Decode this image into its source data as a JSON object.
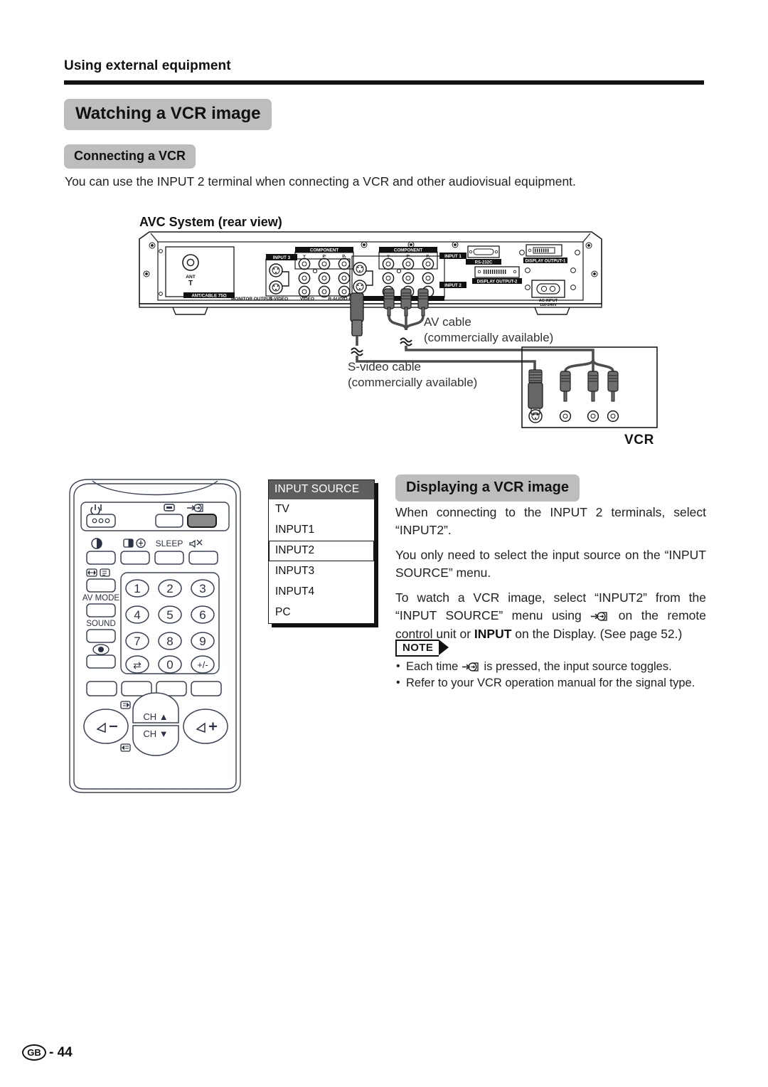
{
  "header": {
    "running_head": "Using external equipment"
  },
  "sections": {
    "watching_title": "Watching a VCR image",
    "connecting_title": "Connecting a VCR",
    "intro_text": "You can use the INPUT 2 terminal when connecting a VCR and other audiovisual equipment.",
    "avc_label": "AVC System (rear view)",
    "displaying_title": "Displaying a VCR image"
  },
  "diagram": {
    "av_cable_caption": "AV cable\n(commercially available)",
    "svideo_cable_caption": "S-video cable\n(commercially available)",
    "vcr_label": "VCR",
    "rear_panel_labels": {
      "ant": "ANT",
      "ant_cable": "ANT/CABLE 75Ω",
      "monitor_output": "MONITOR OUTPUT",
      "s_video": "S-VIDEO",
      "video": "VIDEO",
      "r_audio_l": "R-AUDIO-L",
      "component": "COMPONENT",
      "component_y": "Y",
      "component_pb": "PB",
      "component_pr": "PR",
      "input1": "INPUT 1",
      "input2": "INPUT 2",
      "input3": "INPUT 3",
      "rs232c": "RS-232C",
      "display_output_1": "DISPLAY OUTPUT-1",
      "display_output_2": "DISPLAY OUTPUT-2",
      "ac_input": "AC INPUT",
      "ac_input_volts": "110-240V"
    }
  },
  "input_source_menu": {
    "title": "INPUT SOURCE",
    "items": [
      {
        "label": "TV",
        "selected": false
      },
      {
        "label": "INPUT1",
        "selected": false
      },
      {
        "label": "INPUT2",
        "selected": true
      },
      {
        "label": "INPUT3",
        "selected": false
      },
      {
        "label": "INPUT4",
        "selected": false
      },
      {
        "label": "PC",
        "selected": false
      }
    ]
  },
  "displaying": {
    "p1": "When connecting to the INPUT 2 terminals, select “INPUT2”.",
    "p2": "You only need to select the input source on the “INPUT SOURCE” menu.",
    "p3_before": "To watch a VCR image, select “INPUT2” from the “INPUT SOURCE” menu using ",
    "p3_middle": " on the remote control unit or ",
    "p3_bold": "INPUT",
    "p3_after": " on the Display. (See page 52.)"
  },
  "note": {
    "tag": "NOTE",
    "item1_before": "Each time ",
    "item1_after": " is pressed, the input source toggles.",
    "item2": "Refer to your VCR operation manual for the signal type."
  },
  "remote": {
    "buttons": {
      "power": "power-icon",
      "display": "display-icon",
      "input": "input-icon",
      "sleep": "SLEEP",
      "av_mode": "AV MODE",
      "sound": "SOUND",
      "ch_up": "CH",
      "ch_down": "CH",
      "vol_down": "–",
      "vol_up": "+"
    },
    "keypad": [
      "1",
      "2",
      "3",
      "4",
      "5",
      "6",
      "7",
      "8",
      "9",
      "⇄",
      "0",
      "+/-"
    ]
  },
  "footer": {
    "region": "GB",
    "page": "- 44"
  }
}
